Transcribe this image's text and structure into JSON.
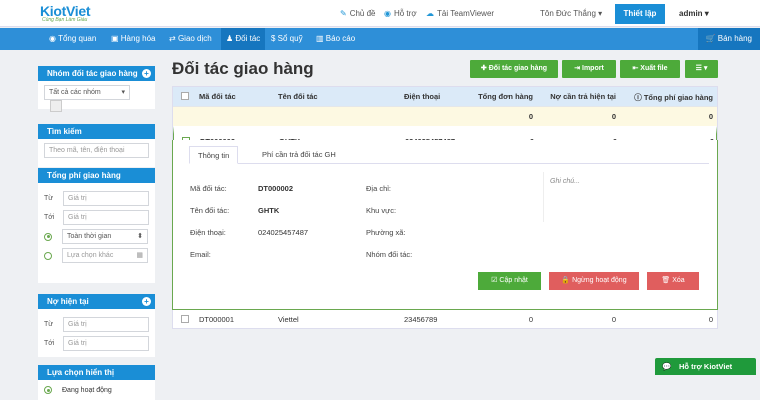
{
  "app": {
    "logo": "KiotViet",
    "tagline": "Cùng Bạn Làm Giàu"
  },
  "topbar": {
    "theme": "Chủ đề",
    "help": "Hỗ trợ",
    "teamviewer": "Tải TeamViewer",
    "branch": "Tôn Đức Thắng",
    "setup": "Thiết lập",
    "user": "admin"
  },
  "nav": {
    "items": [
      "Tổng quan",
      "Hàng hóa",
      "Giao dịch",
      "Đối tác",
      "Sổ quỹ",
      "Báo cáo"
    ],
    "sell": "Bán hàng"
  },
  "sidebar": {
    "group_head": "Nhóm đối tác giao hàng",
    "group_select": "Tất cả các nhóm",
    "search_head": "Tìm kiếm",
    "search_placeholder": "Theo mã, tên, điện thoại",
    "fee_head": "Tổng phí giao hàng",
    "from": "Từ",
    "to": "Tới",
    "value_placeholder": "Giá trị",
    "all_time": "Toàn thời gian",
    "other": "Lựa chọn khác",
    "debt_head": "Nợ hiện tại",
    "display_head": "Lựa chọn hiển thị",
    "active": "Đang hoạt động"
  },
  "page": {
    "title": "Đối tác giao hàng",
    "add": "Đối tác giao hàng",
    "import": "Import",
    "export": "Xuất file"
  },
  "table": {
    "columns": [
      "Mã đối tác",
      "Tên đối tác",
      "Điện thoại",
      "Tổng đơn hàng",
      "Nợ cần trả hiện tại",
      "Tổng phí giao hàng"
    ],
    "summary": [
      "0",
      "0",
      "0"
    ],
    "rows": [
      {
        "code": "DT000002",
        "name": "GHTK",
        "phone": "024025457487",
        "orders": "0",
        "debt": "0",
        "fee": "0"
      },
      {
        "code": "DT000001",
        "name": "Viettel",
        "phone": "23456789",
        "orders": "0",
        "debt": "0",
        "fee": "0"
      }
    ]
  },
  "detail": {
    "tabs": [
      "Thông tin",
      "Phí cần trả đối tác GH"
    ],
    "labels": {
      "code": "Mã đối tác:",
      "name": "Tên đối tác:",
      "phone": "Điện thoại:",
      "email": "Email:",
      "address": "Địa chỉ:",
      "area": "Khu vực:",
      "ward": "Phường xã:",
      "group": "Nhóm đối tác:"
    },
    "values": {
      "code": "DT000002",
      "name": "GHTK",
      "phone": "024025457487"
    },
    "note": "Ghi chú...",
    "update": "Cập nhật",
    "stop": "Ngừng hoạt động",
    "delete": "Xóa"
  },
  "support": "Hỗ trợ KiotViet"
}
